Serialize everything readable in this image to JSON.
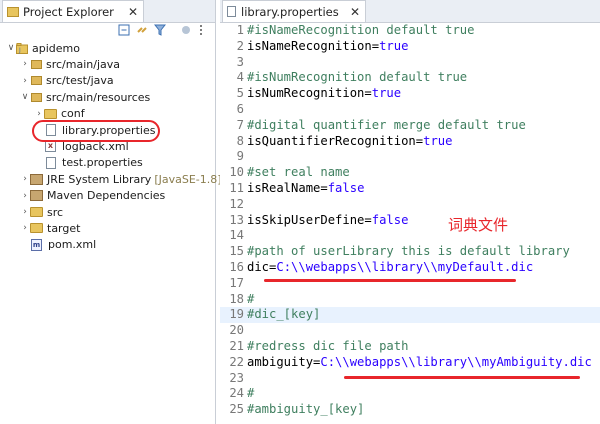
{
  "explorer": {
    "tab_title": "Project Explorer",
    "tab_close": "✕",
    "tree": [
      {
        "label": "apidemo",
        "arrow": "∨",
        "icon": "project-icon",
        "indent": 0
      },
      {
        "label": "src/main/java",
        "arrow": "›",
        "icon": "package-icon",
        "indent": 1
      },
      {
        "label": "src/test/java",
        "arrow": "›",
        "icon": "package-icon",
        "indent": 1
      },
      {
        "label": "src/main/resources",
        "arrow": "∨",
        "icon": "package-icon",
        "indent": 1
      },
      {
        "label": "conf",
        "arrow": "›",
        "icon": "folder-icon",
        "indent": 2
      },
      {
        "label": "library.properties",
        "arrow": "",
        "icon": "file-icon",
        "indent": 2
      },
      {
        "label": "logback.xml",
        "arrow": "",
        "icon": "xml-file-icon",
        "indent": 2
      },
      {
        "label": "test.properties",
        "arrow": "",
        "icon": "file-icon",
        "indent": 2
      },
      {
        "label": "JRE System Library",
        "decoration": "[JavaSE-1.8]",
        "arrow": "›",
        "icon": "library-icon",
        "indent": 1
      },
      {
        "label": "Maven Dependencies",
        "arrow": "›",
        "icon": "library-icon",
        "indent": 1
      },
      {
        "label": "src",
        "arrow": "›",
        "icon": "folder-icon",
        "indent": 1
      },
      {
        "label": "target",
        "arrow": "›",
        "icon": "folder-icon",
        "indent": 1
      },
      {
        "label": "pom.xml",
        "arrow": "",
        "icon": "pom-file-icon",
        "indent": 1
      }
    ]
  },
  "editor": {
    "tab_title": "library.properties",
    "tab_close": "✕",
    "annotation": "词典文件",
    "lines": [
      {
        "n": "1",
        "type": "comment",
        "text": "#isNameRecognition default true"
      },
      {
        "n": "2",
        "type": "kv",
        "key": "isNameRecognition=",
        "value": "true"
      },
      {
        "n": "3",
        "type": "blank",
        "text": ""
      },
      {
        "n": "4",
        "type": "comment",
        "text": "#isNumRecognition default true"
      },
      {
        "n": "5",
        "type": "kv",
        "key": "isNumRecognition=",
        "value": "true"
      },
      {
        "n": "6",
        "type": "blank",
        "text": ""
      },
      {
        "n": "7",
        "type": "comment",
        "text": "#digital quantifier merge default true"
      },
      {
        "n": "8",
        "type": "kv",
        "key": "isQuantifierRecognition=",
        "value": "true"
      },
      {
        "n": "9",
        "type": "blank",
        "text": ""
      },
      {
        "n": "10",
        "type": "comment",
        "text": "#set real name"
      },
      {
        "n": "11",
        "type": "kv",
        "key": "isRealName=",
        "value": "false"
      },
      {
        "n": "12",
        "type": "blank",
        "text": ""
      },
      {
        "n": "13",
        "type": "kv",
        "key": "isSkipUserDefine=",
        "value": "false"
      },
      {
        "n": "14",
        "type": "blank",
        "text": ""
      },
      {
        "n": "15",
        "type": "comment",
        "text": "#path of userLibrary this is default library"
      },
      {
        "n": "16",
        "type": "kv",
        "key": "dic=",
        "value": "C:\\\\webapps\\\\library\\\\myDefault.dic"
      },
      {
        "n": "17",
        "type": "blank",
        "text": ""
      },
      {
        "n": "18",
        "type": "comment",
        "text": "#"
      },
      {
        "n": "19",
        "type": "comment",
        "text": "#dic_[key]",
        "highlight": true
      },
      {
        "n": "20",
        "type": "blank",
        "text": ""
      },
      {
        "n": "21",
        "type": "comment",
        "text": "#redress dic file path"
      },
      {
        "n": "22",
        "type": "kv",
        "key": "ambiguity=",
        "value": "C:\\\\webapps\\\\library\\\\myAmbiguity.dic"
      },
      {
        "n": "23",
        "type": "blank",
        "text": ""
      },
      {
        "n": "24",
        "type": "comment",
        "text": "#"
      },
      {
        "n": "25",
        "type": "comment",
        "text": "#ambiguity_[key]"
      }
    ]
  },
  "colors": {
    "comment": "#3f7f5f",
    "value": "#2a00ff",
    "annotation": "#e8262b",
    "highlight_line": "#e8f2fe"
  }
}
